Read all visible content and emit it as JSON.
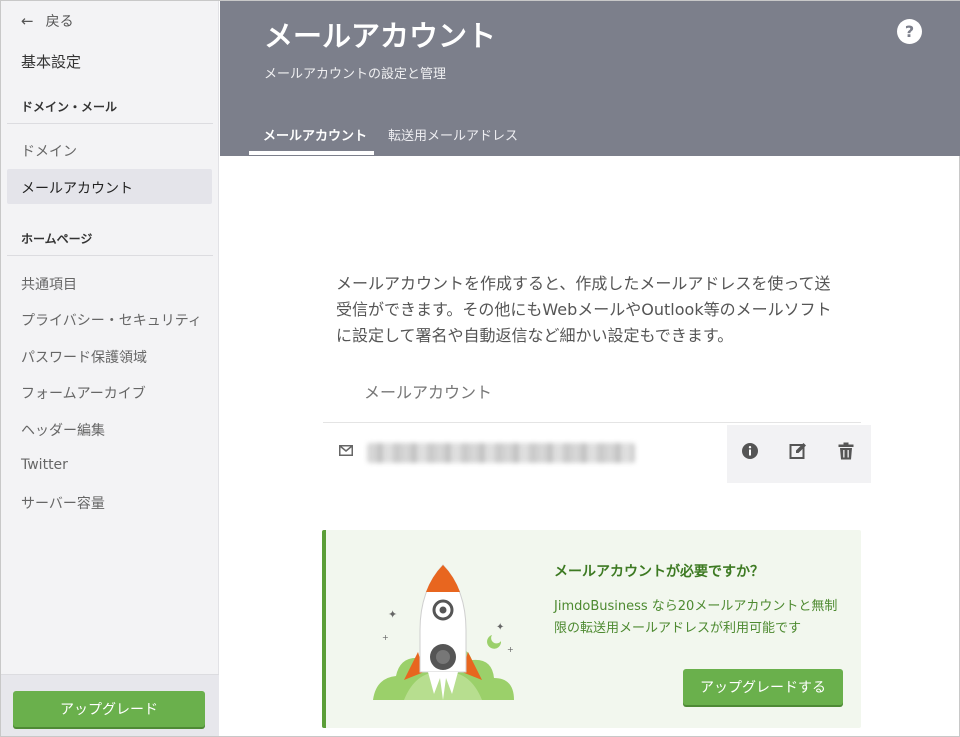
{
  "sidebar": {
    "back_label": "戻る",
    "title": "基本設定",
    "sections": [
      {
        "heading": "ドメイン・メール",
        "items": [
          "ドメイン",
          "メールアカウント"
        ]
      },
      {
        "heading": "ホームページ",
        "items": [
          "共通項目",
          "プライバシー・セキュリティ",
          "パスワード保護領域",
          "フォームアーカイブ",
          "ヘッダー編集",
          "Twitter",
          "サーバー容量"
        ]
      }
    ],
    "active_item": "メールアカウント",
    "upgrade_label": "アップグレード"
  },
  "header": {
    "title": "メールアカウント",
    "subtitle": "メールアカウントの設定と管理",
    "help_label": "?",
    "tabs": [
      {
        "label": "メールアカウント",
        "active": true
      },
      {
        "label": "転送用メールアドレス",
        "active": false
      }
    ]
  },
  "main": {
    "intro_lines": [
      "メールアカウントを作成すると、作成したメールアドレスを使って送",
      "受信ができます。その他にもWebメールやOutlook等のメールソフト",
      "に設定して署名や自動返信など細かい設定もできます。"
    ],
    "account_list_header": "メールアカウント",
    "accounts": [
      {
        "icon": "mail-icon",
        "email": "",
        "actions": [
          "info-icon",
          "edit-icon",
          "trash-icon"
        ]
      }
    ]
  },
  "promo": {
    "title": "メールアカウントが必要ですか？",
    "text_lines": [
      "JimdoBusiness なら20メールアカウントと無制",
      "限の転送用メールアドレスが利用可能です"
    ],
    "button_label": "アップグレードする",
    "image": "rocket-illustration"
  },
  "colors": {
    "header_bg": "#7c7f8b",
    "sidebar_bg": "#f3f3f5",
    "accent_green": "#6ab04c",
    "promo_bg": "#f2f7ee",
    "promo_text": "#3d7a22"
  }
}
